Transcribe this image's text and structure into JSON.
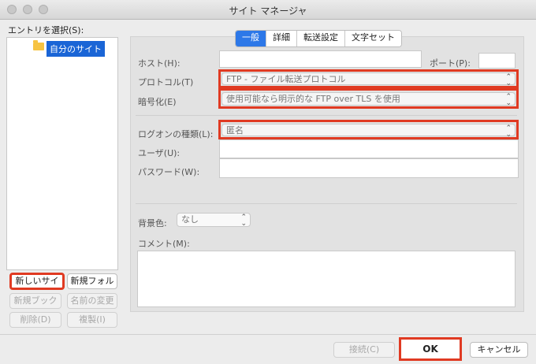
{
  "window": {
    "title": "サイト マネージャ"
  },
  "sidebar": {
    "label": "エントリを選択(S):",
    "tree": {
      "folder_label": "自分のサイト"
    },
    "buttons": {
      "new_site": "新しいサイ",
      "new_folder": "新規フォル",
      "new_bookmark": "新規ブック",
      "rename": "名前の変更",
      "delete": "削除(D)",
      "duplicate": "複製(I)"
    }
  },
  "tabs": [
    {
      "label": "一般"
    },
    {
      "label": "詳細"
    },
    {
      "label": "転送設定"
    },
    {
      "label": "文字セット"
    }
  ],
  "general": {
    "host_label": "ホスト(H):",
    "host_value": "",
    "port_label": "ポート(P):",
    "port_value": "",
    "protocol_label": "プロトコル(T)",
    "protocol_value": "FTP - ファイル転送プロトコル",
    "encryption_label": "暗号化(E)",
    "encryption_value": "使用可能なら明示的な FTP over TLS を使用",
    "logon_type_label": "ログオンの種類(L):",
    "logon_type_value": "匿名",
    "user_label": "ユーザ(U):",
    "user_value": "",
    "password_label": "パスワード(W):",
    "password_value": "",
    "bg_color_label": "背景色:",
    "bg_color_value": "なし",
    "comment_label": "コメント(M):",
    "comment_value": ""
  },
  "footer": {
    "connect": "接続(C)",
    "ok": "OK",
    "cancel": "キャンセル"
  },
  "colors": {
    "accent": "#2d78e8",
    "highlight_box": "#e03a22",
    "selection": "#1a65d6"
  }
}
